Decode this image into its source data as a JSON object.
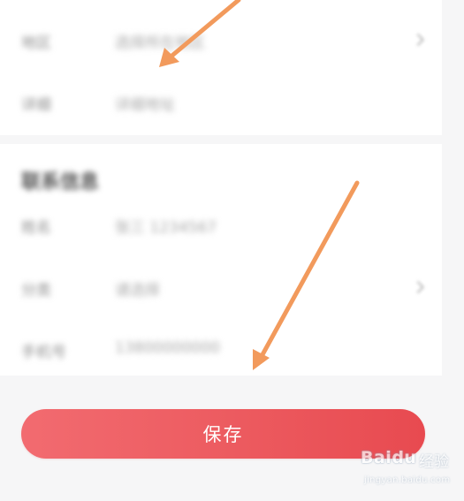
{
  "form": {
    "rows_top": [
      {
        "label": "地区",
        "value": "选择所在地区"
      },
      {
        "label": "详细",
        "value": "详细地址"
      }
    ],
    "section_title": "联系信息",
    "rows_bottom": [
      {
        "label": "姓名",
        "value": "张三 1234567"
      },
      {
        "label": "分类",
        "value": "请选择"
      },
      {
        "label": "手机号",
        "value": "13800000000"
      }
    ]
  },
  "save_button": {
    "label": "保存"
  },
  "watermark": {
    "logo": "Baidu",
    "name": "经验",
    "url": "jingyan.baidu.com"
  },
  "colors": {
    "accent": "#ec5a5f",
    "arrow": "#f29a5c"
  },
  "icons": {
    "chevron": "chevron-right-icon",
    "arrow": "arrow-annotation-icon"
  }
}
